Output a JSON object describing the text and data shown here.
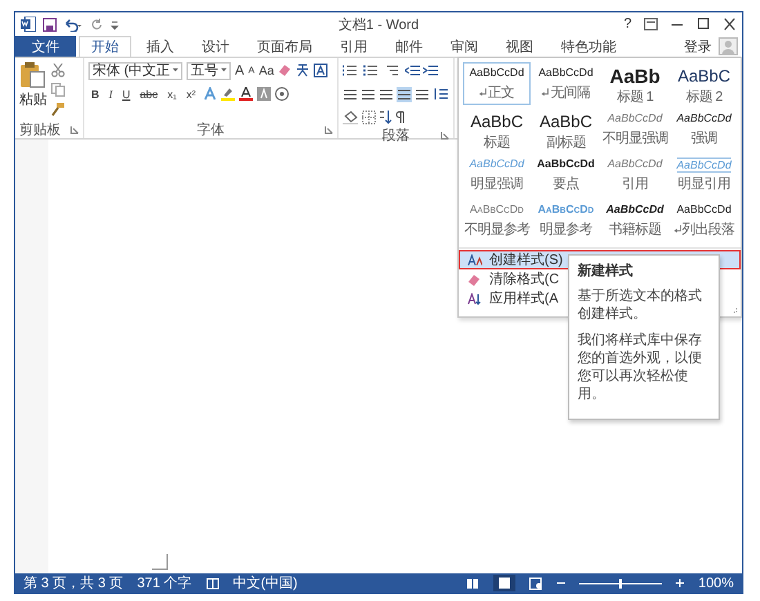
{
  "window": {
    "title": "文档1 - Word",
    "help": "?"
  },
  "tabs": [
    {
      "label": "文件",
      "kind": "file",
      "selected": false
    },
    {
      "label": "开始",
      "kind": "tab",
      "selected": true
    },
    {
      "label": "插入",
      "kind": "tab",
      "selected": false
    },
    {
      "label": "设计",
      "kind": "tab",
      "selected": false
    },
    {
      "label": "页面布局",
      "kind": "tab",
      "selected": false
    },
    {
      "label": "引用",
      "kind": "tab",
      "selected": false
    },
    {
      "label": "邮件",
      "kind": "tab",
      "selected": false
    },
    {
      "label": "审阅",
      "kind": "tab",
      "selected": false
    },
    {
      "label": "视图",
      "kind": "tab",
      "selected": false
    },
    {
      "label": "特色功能",
      "kind": "tab",
      "selected": false
    }
  ],
  "account": {
    "label": "登录"
  },
  "ribbon": {
    "clipboard": {
      "paste": "粘贴",
      "label": "剪贴板"
    },
    "font": {
      "name": "宋体 (中文正",
      "size": "五号",
      "grow": "A",
      "shrink": "A",
      "case": "Aa",
      "format": [
        "B",
        "I",
        "U",
        "abc",
        "x₁",
        "x²"
      ],
      "label": "字体"
    },
    "paragraph": {
      "label": "段落",
      "alignment": [
        {
          "selected": false
        },
        {
          "selected": false
        },
        {
          "selected": false
        },
        {
          "selected": true
        },
        {
          "selected": false
        }
      ]
    }
  },
  "styles_gallery": {
    "styles": [
      {
        "sample": "AaBbCcDd",
        "name": "正文",
        "kind": "body",
        "para_mark": true,
        "selected": true
      },
      {
        "sample": "AaBbCcDd",
        "name": "无间隔",
        "kind": "body",
        "para_mark": true,
        "selected": false
      },
      {
        "sample": "AaBb",
        "name": "标题 1",
        "kind": "heading1",
        "para_mark": false,
        "selected": false
      },
      {
        "sample": "AaBbC",
        "name": "标题 2",
        "kind": "heading2",
        "para_mark": false,
        "selected": false
      },
      {
        "sample": "AaBbC",
        "name": "标题",
        "kind": "title",
        "para_mark": false,
        "selected": false
      },
      {
        "sample": "AaBbC",
        "name": "副标题",
        "kind": "title",
        "para_mark": false,
        "selected": false
      },
      {
        "sample": "AaBbCcDd",
        "name": "不明显强调",
        "kind": "subtle",
        "para_mark": false,
        "selected": false
      },
      {
        "sample": "AaBbCcDd",
        "name": "强调",
        "kind": "emphasis",
        "para_mark": false,
        "selected": false
      },
      {
        "sample": "AaBbCcDd",
        "name": "明显强调",
        "kind": "intense",
        "para_mark": false,
        "selected": false
      },
      {
        "sample": "AaBbCcDd",
        "name": "要点",
        "kind": "strong",
        "para_mark": false,
        "selected": false
      },
      {
        "sample": "AaBbCcDd",
        "name": "引用",
        "kind": "subtle",
        "para_mark": false,
        "selected": false
      },
      {
        "sample": "AaBbCcDd",
        "name": "明显引用",
        "kind": "intense_quote",
        "para_mark": false,
        "selected": false
      },
      {
        "sample": "AaBbCcDd",
        "name": "不明显参考",
        "kind": "subtle_ref",
        "para_mark": false,
        "selected": false
      },
      {
        "sample": "AaBbCcDd",
        "name": "明显参考",
        "kind": "intense_ref",
        "para_mark": false,
        "selected": false
      },
      {
        "sample": "AaBbCcDd",
        "name": "书籍标题",
        "kind": "book",
        "para_mark": false,
        "selected": false
      },
      {
        "sample": "AaBbCcDd",
        "name": "列出段落",
        "kind": "body",
        "para_mark": true,
        "selected": false
      }
    ],
    "menu": [
      {
        "label": "创建样式(S)",
        "kind": "create",
        "highlighted": true
      },
      {
        "label": "清除格式(C",
        "kind": "clear",
        "highlighted": false
      },
      {
        "label": "应用样式(A",
        "kind": "apply",
        "highlighted": false
      }
    ]
  },
  "tooltip": {
    "title": "新建样式",
    "paragraphs": [
      "基于所选文本的格式创建样式。",
      "我们将样式库中保存您的首选外观，以便您可以再次轻松使用。"
    ]
  },
  "status_bar": {
    "page": "第 3 页，共 3 页",
    "words": "371 个字",
    "language": "中文(中国)",
    "zoom": "100%",
    "zoom_slider": {
      "level": 0.5
    }
  }
}
